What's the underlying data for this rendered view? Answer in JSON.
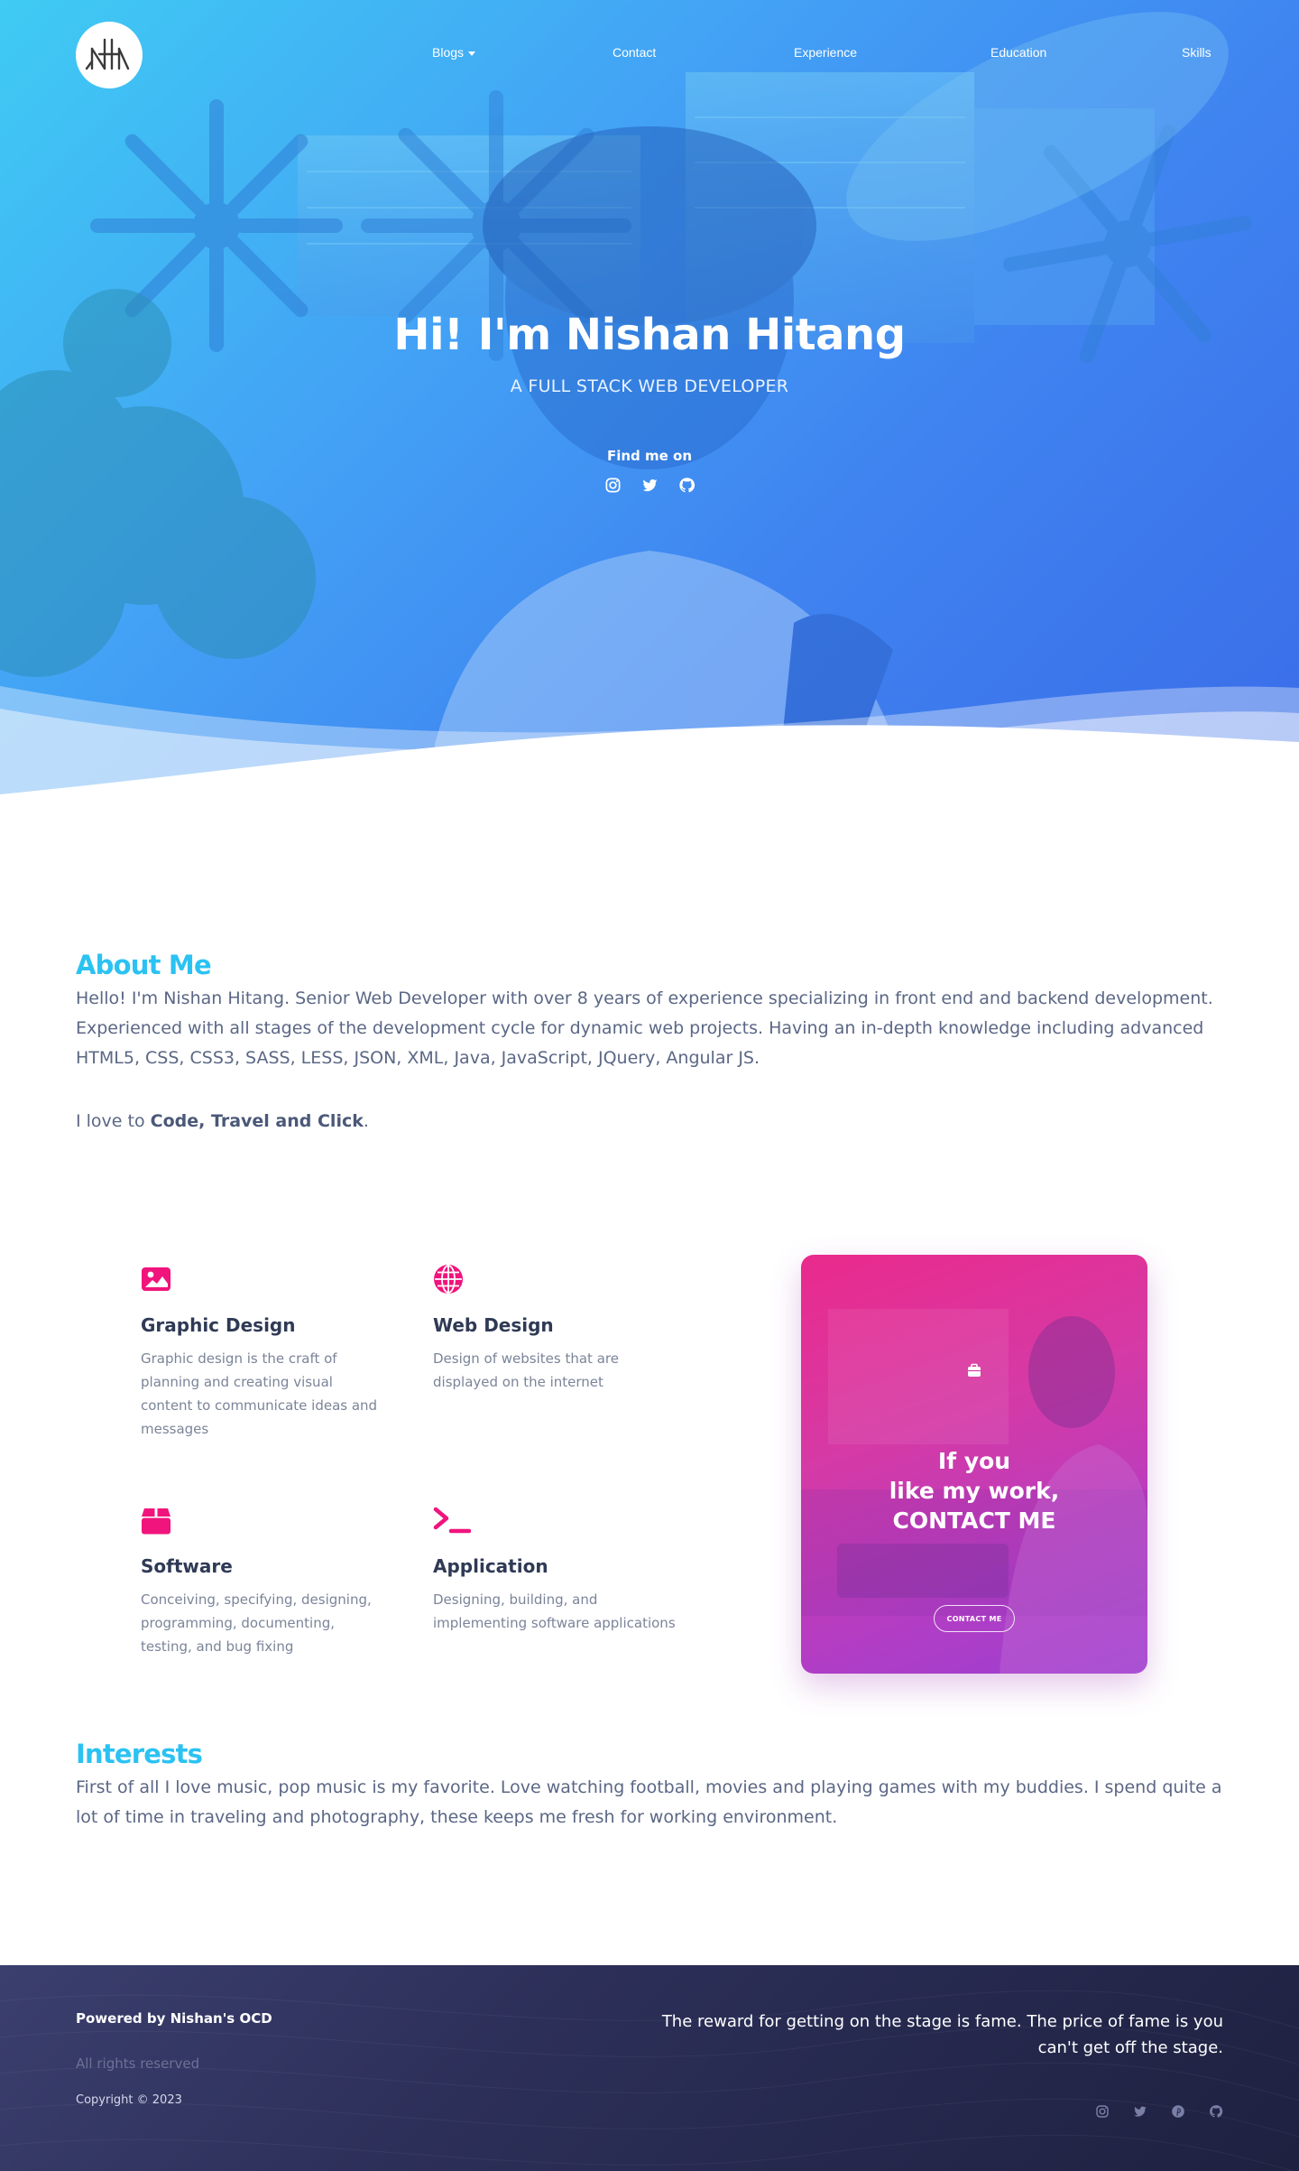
{
  "nav": {
    "logo_alt": "logo",
    "items": [
      {
        "label": "Blogs",
        "has_dropdown": true
      },
      {
        "label": "Contact"
      },
      {
        "label": "Experience"
      },
      {
        "label": "Education"
      },
      {
        "label": "Skills"
      }
    ]
  },
  "hero": {
    "title": "Hi! I'm Nishan Hitang",
    "subtitle": "A FULL STACK WEB DEVELOPER",
    "find_me": "Find me on",
    "social_icons": [
      "instagram-icon",
      "twitter-icon",
      "github-icon"
    ],
    "gradient": [
      "#3fcbf3",
      "#3a6ce8"
    ]
  },
  "about": {
    "title": "About Me",
    "paragraph": "Hello! I'm Nishan Hitang. Senior Web Developer with over 8 years of experience specializing in front end and backend development. Experienced with all stages of the development cycle for dynamic web projects. Having an in-depth knowledge including advanced HTML5, CSS, CSS3, SASS, LESS, JSON, XML, Java, JavaScript, JQuery, Angular JS.",
    "love_prefix": "I love to ",
    "love_bold": "Code, Travel and Click",
    "love_suffix": "."
  },
  "services": [
    {
      "icon": "image-icon",
      "title": "Graphic Design",
      "description": "Graphic design is the craft of planning and creating visual content to communicate ideas and messages"
    },
    {
      "icon": "globe-icon",
      "title": "Web Design",
      "description": "Design of websites that are displayed on the internet"
    },
    {
      "icon": "box-icon",
      "title": "Software",
      "description": "Conceiving, specifying, designing, programming, documenting, testing, and bug fixing"
    },
    {
      "icon": "terminal-icon",
      "title": "Application",
      "description": "Designing, building, and implementing software applications"
    }
  ],
  "contact_card": {
    "line1": "If you",
    "line2": "like my work,",
    "line3": "CONTACT ME",
    "button": "CONTACT ME",
    "icon": "briefcase-icon"
  },
  "interests": {
    "title": "Interests",
    "paragraph": "First of all I love music, pop music is my favorite. Love watching football, movies and playing games with my buddies. I spend quite a lot of time in traveling and photography, these keeps me fresh for working environment."
  },
  "footer": {
    "powered": "Powered by Nishan's OCD",
    "rights": "All rights reserved",
    "copyright": "Copyright © 2023",
    "quote": "The reward for getting on the stage is fame. The price of fame is you can't get off the stage.",
    "social_icons": [
      "instagram-icon",
      "twitter-icon",
      "pinterest-icon",
      "github-icon"
    ]
  },
  "colors": {
    "accent": "#2bc2f2",
    "pink": "#f0147c",
    "text": "#5b6785",
    "footer_bg": "#2c2f58"
  }
}
